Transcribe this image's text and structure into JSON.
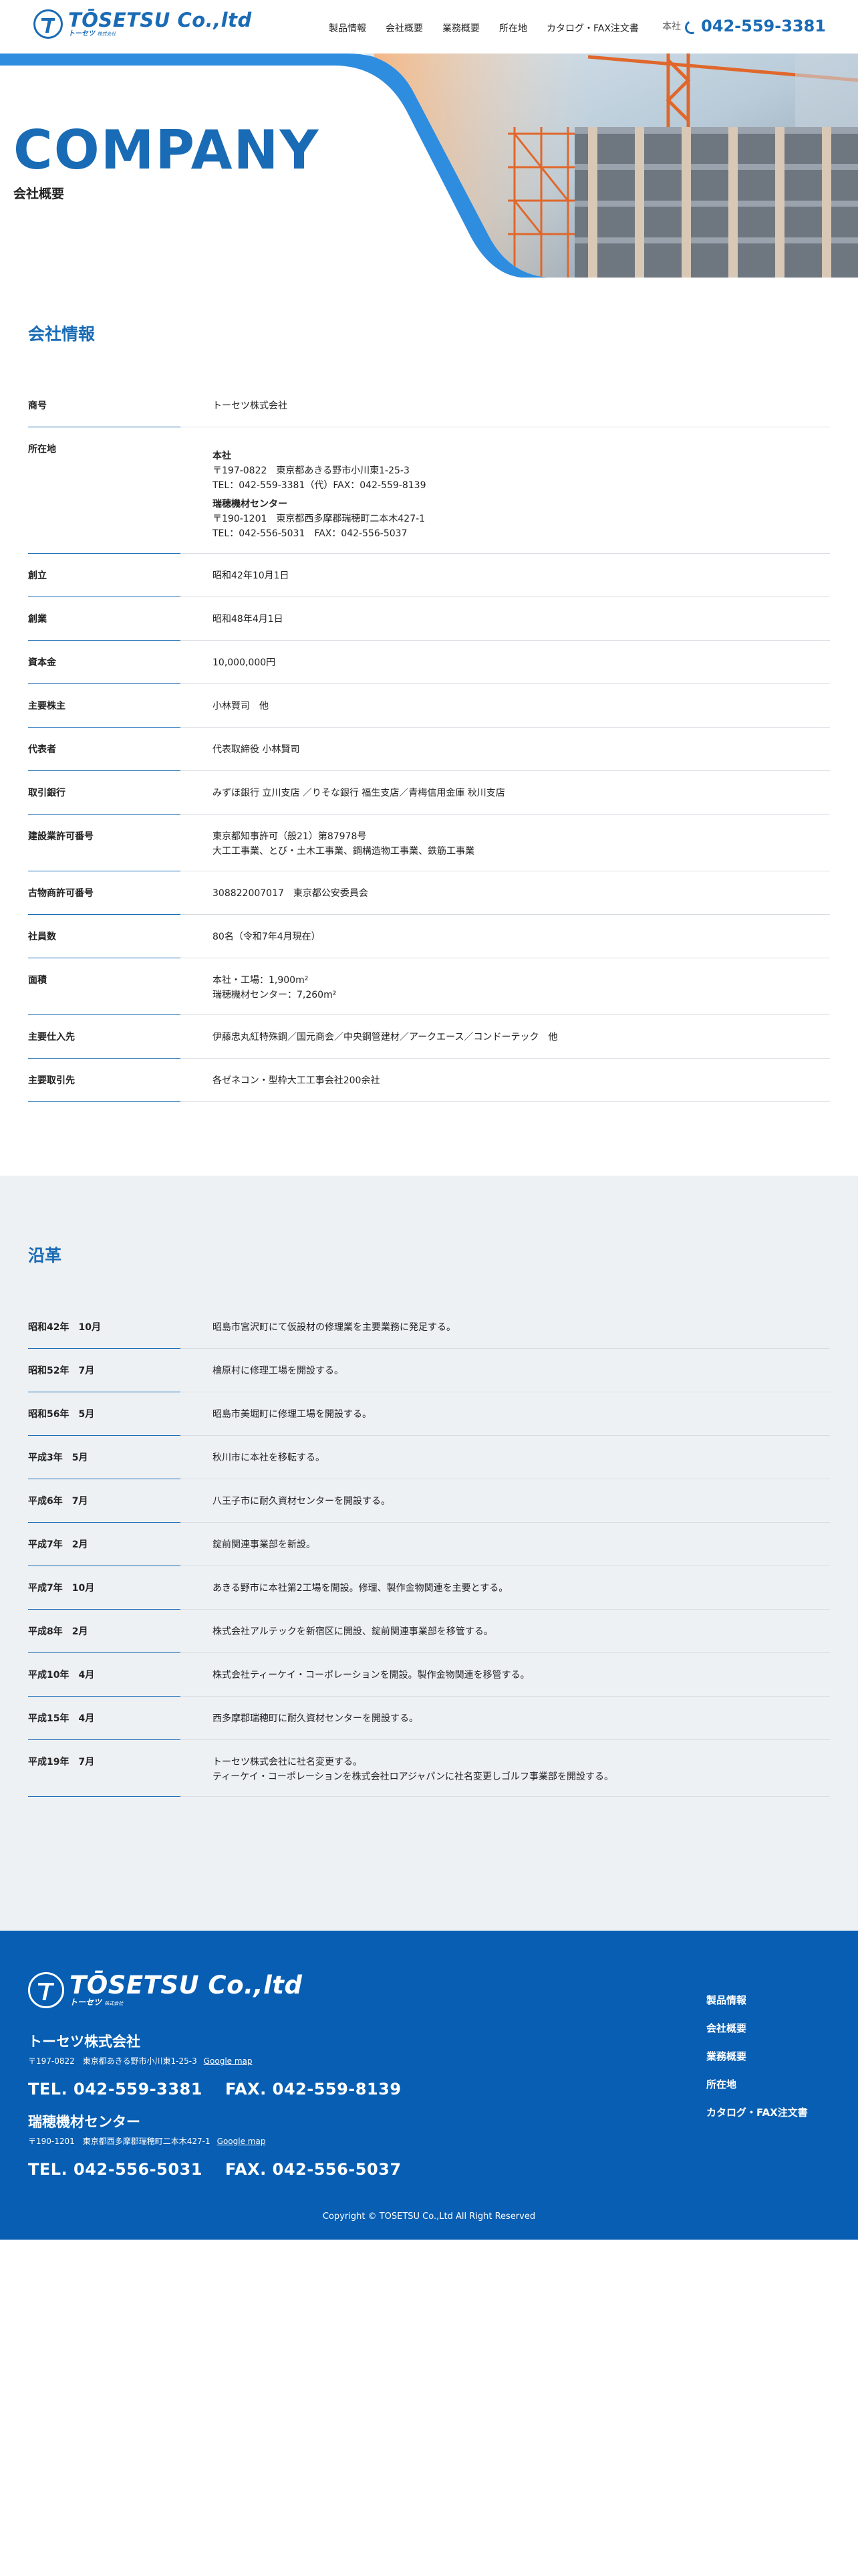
{
  "header": {
    "logo_text": "TŌSETSU Co.,ltd",
    "logo_sub": "トーセツ",
    "logo_sub_small": "株式会社",
    "nav": [
      "製品情報",
      "会社概要",
      "業務概要",
      "所在地",
      "カタログ・FAX注文書"
    ],
    "phone_label": "本社",
    "phone": "042-559-3381"
  },
  "hero": {
    "title": "COMPANY",
    "subtitle": "会社概要"
  },
  "company": {
    "title": "会社情報",
    "rows": [
      {
        "label": "商号",
        "value": "トーセツ株式会社"
      },
      {
        "label": "所在地",
        "blocks": [
          {
            "name": "本社",
            "lines": [
              "〒197-0822　東京都あきる野市小川東1-25-3",
              "TEL：042-559-3381（代）FAX：042-559-8139"
            ]
          },
          {
            "name": "瑞穂機材センター",
            "lines": [
              "〒190-1201　東京都西多摩郡瑞穂町二本木427-1",
              "TEL：042-556-5031　FAX：042-556-5037"
            ]
          }
        ]
      },
      {
        "label": "創立",
        "value": "昭和42年10月1日"
      },
      {
        "label": "創業",
        "value": "昭和48年4月1日"
      },
      {
        "label": "資本金",
        "value": "10,000,000円"
      },
      {
        "label": "主要株主",
        "value": "小林賢司　他"
      },
      {
        "label": "代表者",
        "value": "代表取締役 小林賢司"
      },
      {
        "label": "取引銀行",
        "value": "みずほ銀行 立川支店 ／りそな銀行 福生支店／青梅信用金庫 秋川支店"
      },
      {
        "label": "建設業許可番号",
        "lines": [
          "東京都知事許可（般21）第87978号",
          "大工工事業、とび・土木工事業、鋼構造物工事業、鉄筋工事業"
        ]
      },
      {
        "label": "古物商許可番号",
        "value": "308822007017　東京都公安委員会"
      },
      {
        "label": "社員数",
        "value": "80名（令和7年4月現在）"
      },
      {
        "label": "面積",
        "lines": [
          "本社・工場：1,900m²",
          "瑞穂機材センター：7,260m²"
        ]
      },
      {
        "label": "主要仕入先",
        "value": "伊藤忠丸紅特殊鋼／国元商会／中央鋼管建材／アークエース／コンドーテック　他"
      },
      {
        "label": "主要取引先",
        "value": "各ゼネコン・型枠大工工事会社200余社"
      }
    ]
  },
  "history": {
    "title": "沿革",
    "rows": [
      {
        "date": "昭和42年　10月",
        "lines": [
          "昭島市宮沢町にて仮設材の修理業を主要業務に発足する。"
        ]
      },
      {
        "date": "昭和52年　7月",
        "lines": [
          "檜原村に修理工場を開設する。"
        ]
      },
      {
        "date": "昭和56年　5月",
        "lines": [
          "昭島市美堀町に修理工場を開設する。"
        ]
      },
      {
        "date": "平成3年　5月",
        "lines": [
          "秋川市に本社を移転する。"
        ]
      },
      {
        "date": "平成6年　7月",
        "lines": [
          "八王子市に耐久資材センターを開設する。"
        ]
      },
      {
        "date": "平成7年　2月",
        "lines": [
          "錠前関連事業部を新設。"
        ]
      },
      {
        "date": "平成7年　10月",
        "lines": [
          "あきる野市に本社第2工場を開設。修理、製作金物関連を主要とする。"
        ]
      },
      {
        "date": "平成8年　2月",
        "lines": [
          "株式会社アルテックを新宿区に開設、錠前関連事業部を移管する。"
        ]
      },
      {
        "date": "平成10年　4月",
        "lines": [
          "株式会社ティーケイ・コーポレーションを開設。製作金物関連を移管する。"
        ]
      },
      {
        "date": "平成15年　4月",
        "lines": [
          "西多摩郡瑞穂町に耐久資材センターを開設する。"
        ]
      },
      {
        "date": "平成19年　7月",
        "lines": [
          "トーセツ株式会社に社名変更する。",
          "ティーケイ・コーポレーションを株式会社ロアジャパンに社名変更しゴルフ事業部を開設する。"
        ]
      }
    ]
  },
  "footer": {
    "logo_text": "TŌSETSU Co.,ltd",
    "logo_sub": "トーセツ",
    "logo_sub_small": "株式会社",
    "offices": [
      {
        "name": "トーセツ株式会社",
        "address": "〒197-0822　東京都あきる野市小川東1-25-3",
        "map": "Google map",
        "tel": "TEL. 042-559-3381",
        "fax": "FAX. 042-559-8139"
      },
      {
        "name": "瑞穂機材センター",
        "address": "〒190-1201　東京都西多摩郡瑞穂町二本木427-1",
        "map": "Google map",
        "tel": "TEL. 042-556-5031",
        "fax": "FAX. 042-556-5037"
      }
    ],
    "nav": [
      "製品情報",
      "会社概要",
      "業務概要",
      "所在地",
      "カタログ・FAX注文書"
    ],
    "copyright": "Copyright © TOSETSU Co.,Ltd All Right Reserved"
  },
  "colors": {
    "brand_blue": "#1a6bb5",
    "footer_blue": "#075eb3",
    "history_bg": "#eef1f4"
  }
}
